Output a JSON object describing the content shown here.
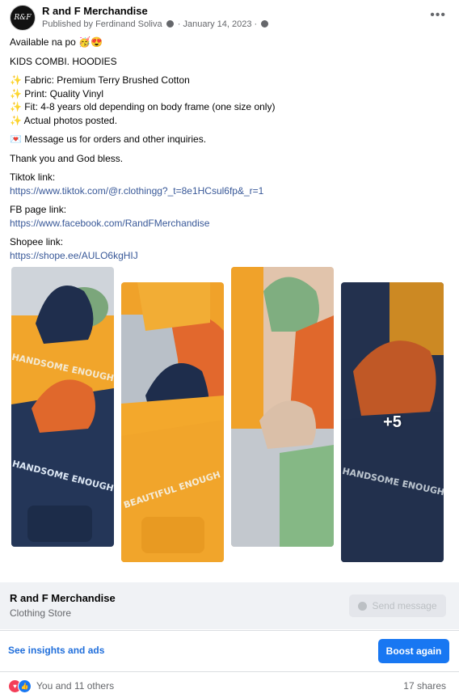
{
  "header": {
    "avatar_text": "R&F",
    "page_name": "R and F Merchandise",
    "published_prefix": "Published by",
    "publisher": "Ferdinand Soliva",
    "date": "January 14, 2023",
    "more": "•••"
  },
  "post": {
    "line1": "Available na po 🥳😍",
    "line2": "KIDS COMBI. HOODIES",
    "fabric": "✨ Fabric: Premium Terry Brushed Cotton",
    "print": "✨ Print: Quality Vinyl",
    "fit": "✨ Fit: 4-8 years old depending on body frame (one size only)",
    "photos": "✨ Actual photos posted.",
    "message": "💌 Message us for orders and other inquiries.",
    "thanks": "Thank you and God bless.",
    "tiktok_label": "Tiktok link:",
    "tiktok_url": "https://www.tiktok.com/@r.clothingg?_t=8e1HCsul6fp&_r=1",
    "fb_label": "FB page link:",
    "fb_url": "https://www.facebook.com/RandFMerchandise",
    "shopee_label": "Shopee link:",
    "shopee_url": "https://shope.ee/AULO6kgHIJ"
  },
  "gallery": {
    "photo_texts": [
      "HANDSOME ENOUGH",
      "BEAUTIFUL ENOUGH",
      "",
      "HANDSOME ENOUGH"
    ],
    "more_count": "+5"
  },
  "cta": {
    "name": "R and F Merchandise",
    "category": "Clothing Store",
    "send_label": "Send message"
  },
  "insights": {
    "link": "See insights and ads",
    "boost_label": "Boost again"
  },
  "footer": {
    "reactions_text": "You and 11 others",
    "shares": "17 shares"
  },
  "colors": {
    "link": "#385898",
    "accent": "#1877f2",
    "insight_link": "#216fdb"
  }
}
